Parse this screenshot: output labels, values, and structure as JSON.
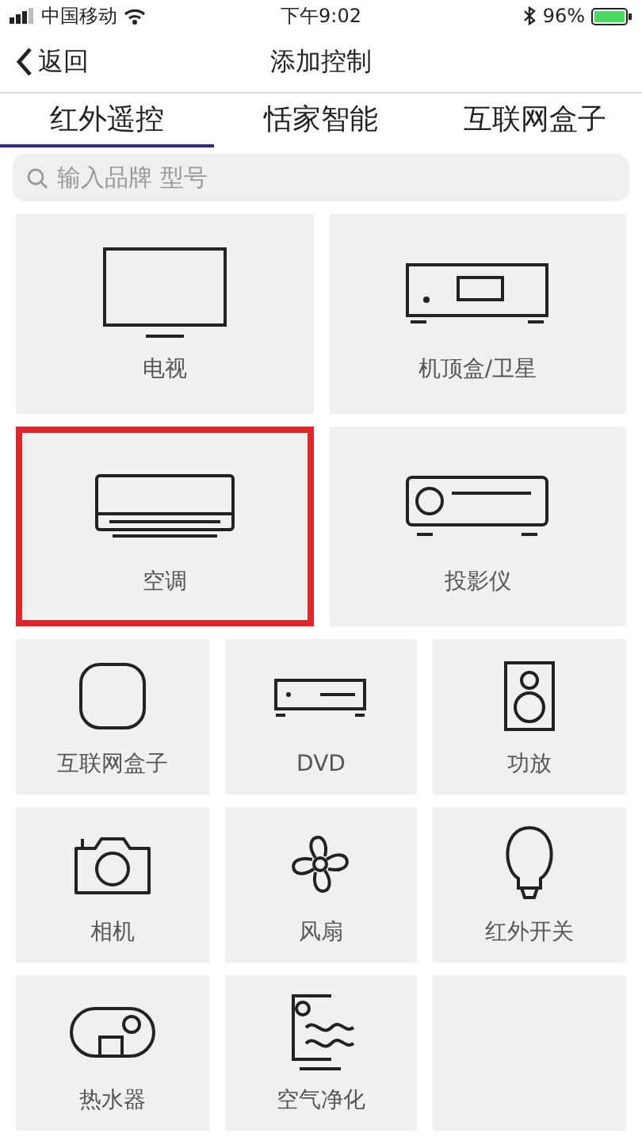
{
  "status_bar": {
    "carrier": "中国移动",
    "time": "下午9:02",
    "battery": "96%"
  },
  "nav": {
    "back": "返回",
    "title": "添加控制"
  },
  "tabs": [
    {
      "label": "红外遥控",
      "selected": true
    },
    {
      "label": "恬家智能",
      "selected": false
    },
    {
      "label": "互联网盒子",
      "selected": false
    }
  ],
  "search": {
    "placeholder": "输入品牌 型号"
  },
  "large_tiles": [
    {
      "label": "电视",
      "selected": false
    },
    {
      "label": "机顶盒/卫星",
      "selected": false
    },
    {
      "label": "空调",
      "selected": true
    },
    {
      "label": "投影仪",
      "selected": false
    }
  ],
  "small_tiles": [
    {
      "label": "互联网盒子",
      "selected": false
    },
    {
      "label": "DVD",
      "selected": false
    },
    {
      "label": "功放",
      "selected": false
    },
    {
      "label": "相机",
      "selected": false
    },
    {
      "label": "风扇",
      "selected": false
    },
    {
      "label": "红外开关",
      "selected": false
    },
    {
      "label": "热水器",
      "selected": false
    },
    {
      "label": "空气净化",
      "selected": false
    },
    {
      "selected": false
    }
  ]
}
